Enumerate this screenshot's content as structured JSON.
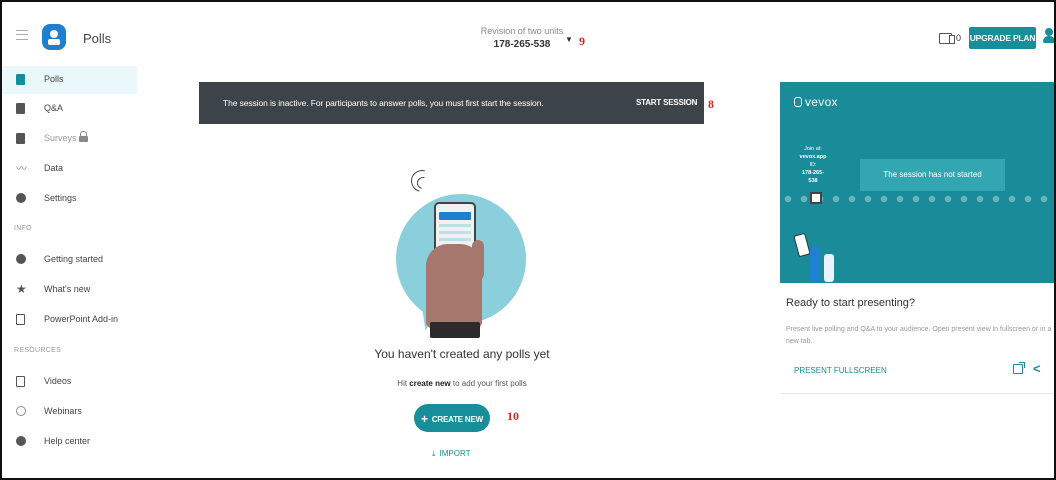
{
  "header": {
    "app_title": "Polls",
    "session_name": "Revision of two units",
    "session_id": "178-265-538",
    "device_count": "0",
    "upgrade_label": "UPGRADE PLAN"
  },
  "annotations": {
    "banner": "8",
    "session": "9",
    "create": "10"
  },
  "sidebar": {
    "items": [
      {
        "label": "Polls"
      },
      {
        "label": "Q&A"
      },
      {
        "label": "Surveys"
      },
      {
        "label": "Data"
      },
      {
        "label": "Settings"
      }
    ],
    "info_label": "INFO",
    "info_items": [
      {
        "label": "Getting started"
      },
      {
        "label": "What's new"
      },
      {
        "label": "PowerPoint Add-in"
      }
    ],
    "resources_label": "RESOURCES",
    "resource_items": [
      {
        "label": "Videos"
      },
      {
        "label": "Webinars"
      },
      {
        "label": "Help center"
      }
    ]
  },
  "banner": {
    "text": "The session is inactive. For participants to answer polls, you must first start the session.",
    "action": "START SESSION"
  },
  "empty_state": {
    "title": "You haven't created any polls yet",
    "hint_prefix": "Hit ",
    "hint_bold": "create new",
    "hint_suffix": " to add your first polls",
    "create_label": "CREATE NEW",
    "import_label": "IMPORT"
  },
  "preview": {
    "brand": "vevox",
    "join_label": "Join at:",
    "join_url": "vevox.app",
    "id_label": "ID:",
    "id_value": "178-265-538",
    "status": "The session has not started",
    "title": "Ready to start presenting?",
    "description": "Present live polling and Q&A to your audience. Open present view in fullscreen or in a new tab.",
    "fullscreen_label": "PRESENT FULLSCREEN"
  },
  "colors": {
    "accent": "#178e99",
    "banner": "#3d4449",
    "annotation": "#d42a22"
  }
}
